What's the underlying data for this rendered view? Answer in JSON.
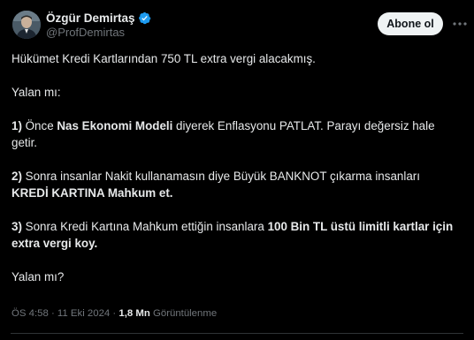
{
  "author": {
    "name": "Özgür Demirtaş",
    "handle": "@ProfDemirtas",
    "verified": true
  },
  "actions": {
    "follow_label": "Abone ol"
  },
  "tweet": {
    "line1": "Hükümet Kredi Kartlarından 750 TL extra vergi alacakmış.",
    "line2": "Yalan mı:",
    "p1_num": "1)",
    "p1_a": " Önce ",
    "p1_bold": "Nas Ekonomi Modeli",
    "p1_b": " diyerek Enflasyonu PATLAT. Parayı değersiz hale getir.",
    "p2_num": "2)",
    "p2_a": " Sonra insanlar Nakit kullanamasın diye Büyük BANKNOT çıkarma insanları ",
    "p2_bold": "KREDİ KARTINA Mahkum et.",
    "p3_num": "3)",
    "p3_a": " Sonra Kredi Kartına Mahkum ettiğin insanlara ",
    "p3_bold": "100 Bin TL üstü limitli kartlar için extra vergi koy.",
    "last": "Yalan mı?"
  },
  "meta": {
    "time": "ÖS 4:58",
    "sep1": " · ",
    "date": "11 Eki 2024",
    "sep2": " · ",
    "views_count": "1,8 Mn",
    "views_label": " Görüntülenme"
  },
  "colors": {
    "background": "#000000",
    "text": "#e7e9ea",
    "secondary": "#71767b",
    "verified": "#1d9bf0",
    "button_bg": "#eff3f4"
  }
}
